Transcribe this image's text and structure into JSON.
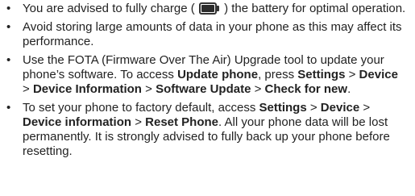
{
  "tips": [
    {
      "before_icon": "You are advised to fully charge ( ",
      "icon": "battery-full-icon",
      "after_icon": " ) the battery for optimal operation."
    },
    {
      "text": "Avoid storing large amounts of data in your phone as this may affect its performance."
    },
    {
      "t1": "Use the FOTA (Firmware Over The Air) Upgrade tool to update your phone’s software. To access ",
      "b1": "Update phone",
      "t2": ", press ",
      "b2": "Settings",
      "t3": " > ",
      "b3": "Device",
      "t4": " > ",
      "b4": "Device Information",
      "t5": " > ",
      "b5": "Software Update",
      "t6": " > ",
      "b6": "Check for new",
      "t7": "."
    },
    {
      "t1": "To set your phone to factory default, access ",
      "b1": "Settings",
      "t2": " > ",
      "b2": "Device",
      "t3": " > ",
      "b3": "Device information",
      "t4": " > ",
      "b4": "Reset Phone",
      "t5": ". All your phone data will be lost permanently. It is strongly advised to fully back up your phone before resetting."
    }
  ],
  "bullet_char": "•"
}
